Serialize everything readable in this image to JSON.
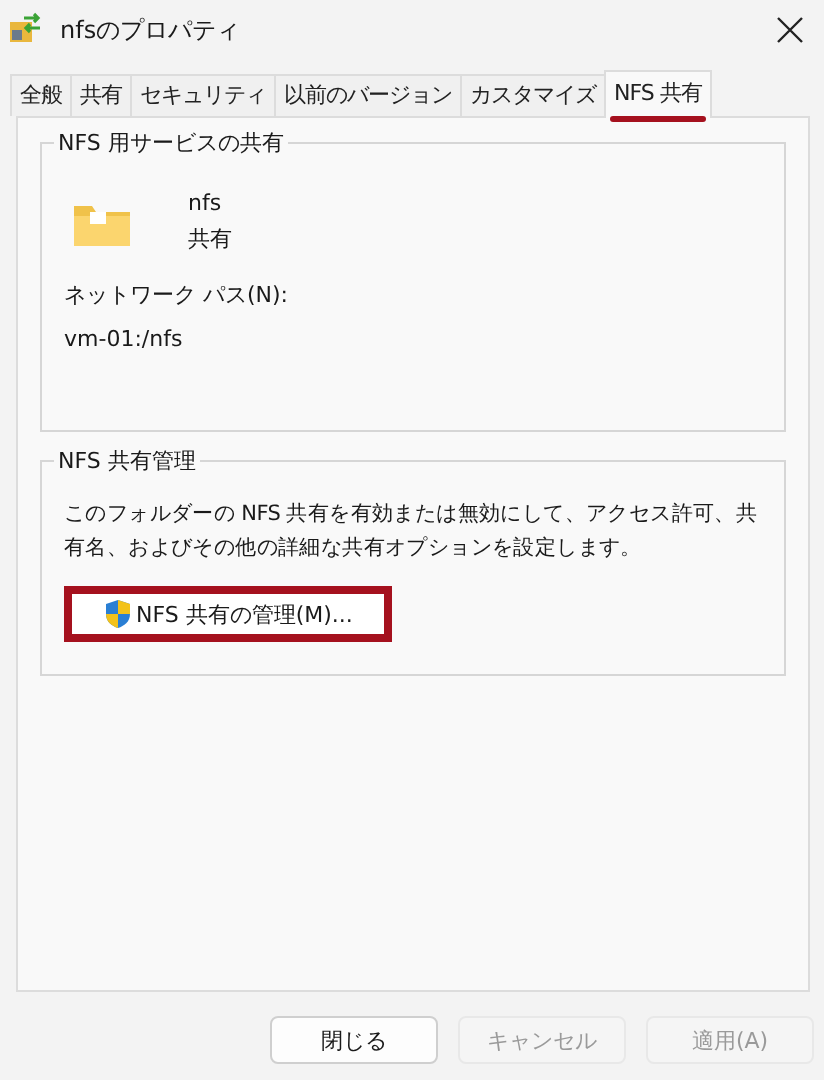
{
  "window": {
    "title": "nfsのプロパティ"
  },
  "tabs": [
    {
      "label": "全般",
      "selected": false
    },
    {
      "label": "共有",
      "selected": false
    },
    {
      "label": "セキュリティ",
      "selected": false
    },
    {
      "label": "以前のバージョン",
      "selected": false
    },
    {
      "label": "カスタマイズ",
      "selected": false
    },
    {
      "label": "NFS 共有",
      "selected": true,
      "highlighted": true
    }
  ],
  "service_group": {
    "title": "NFS 用サービスの共有",
    "folder_name": "nfs",
    "folder_state": "共有",
    "path_label": "ネットワーク パス(N):",
    "path_value": "vm-01:/nfs"
  },
  "manage_group": {
    "title": "NFS 共有管理",
    "description": "このフォルダーの NFS 共有を有効または無効にして、アクセス許可、共有名、およびその他の詳細な共有オプションを設定します。",
    "button": {
      "label": "NFS 共有の管理(M)...",
      "highlighted": true
    }
  },
  "buttons": [
    {
      "label": "閉じる",
      "disabled": false
    },
    {
      "label": "キャンセル",
      "disabled": true
    },
    {
      "label": "適用(A)",
      "disabled": true
    }
  ]
}
